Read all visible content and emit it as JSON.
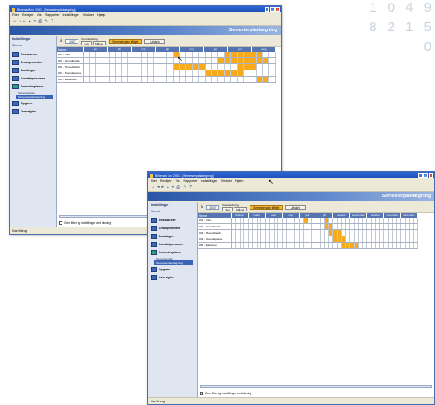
{
  "background_digits": [
    "1 0 4 9",
    "8 2 1 5 0"
  ],
  "window_title": "Birkerød Kro 2000 - [Semesterplanlægning]",
  "menu": [
    "Filer",
    "Rediger",
    "Vis",
    "Rapporter",
    "Indstillinger",
    "Vinduer",
    "Hjælp"
  ],
  "toolbar_tools": [
    "⌂",
    "◂",
    "▸",
    "▴",
    "▾",
    "⎙",
    "✎",
    "?"
  ],
  "header_title": "Semesterplanlægning",
  "sidebar": {
    "head": "Indstillinger",
    "sub": "Skema",
    "items": [
      {
        "label": "Ressourcer",
        "active": false
      },
      {
        "label": "Arrangementer",
        "active": false
      },
      {
        "label": "Bookinger",
        "active": false
      },
      {
        "label": "Kontaktpersoner",
        "active": false
      },
      {
        "label": "Semesterplaner",
        "active": true,
        "children": [
          {
            "label": "Semesterplan",
            "selected": false
          },
          {
            "label": "Semesterplanlægning",
            "selected": true
          }
        ]
      },
      {
        "label": "Opgaver",
        "active": false
      },
      {
        "label": "Oversigter",
        "active": false
      }
    ]
  },
  "filters": {
    "year_label": "År",
    "year_value": "2007",
    "period_caption": "Periodevisning",
    "period_buttons": [
      "Uge",
      "Måned"
    ],
    "orange_button": "Semesterplan tilføjet",
    "plain_button": "Udskriv"
  },
  "grid": {
    "row_header": "Navne",
    "months1": [
      "jan",
      "feb",
      "mar",
      "apr",
      "maj",
      "jun",
      "jul",
      "aug"
    ],
    "months2": [
      "februar",
      "marts",
      "april",
      "maj",
      "juni",
      "juli",
      "august",
      "september",
      "oktober",
      "november",
      "december"
    ],
    "rows": [
      {
        "label": "001 - Intro",
        "cells1": [
          0,
          0,
          0,
          0,
          0,
          0,
          0,
          0,
          0,
          0,
          0,
          0,
          0,
          0,
          1,
          0,
          0,
          0,
          0,
          0,
          0,
          0,
          1,
          1,
          1,
          1,
          1,
          1,
          0,
          0
        ],
        "cells2": [
          0,
          0,
          0,
          0,
          0,
          0,
          0,
          0,
          0,
          0,
          0,
          0,
          0,
          0,
          0,
          0,
          0,
          1,
          0,
          0,
          0,
          0,
          1,
          0,
          0,
          0,
          0,
          0,
          0,
          0,
          0,
          0,
          0,
          0,
          0,
          0,
          0,
          0,
          0,
          0,
          0,
          0,
          0,
          0
        ]
      },
      {
        "label": "002 - Grundforløb",
        "cells1": [
          0,
          0,
          0,
          0,
          0,
          0,
          0,
          0,
          0,
          0,
          0,
          0,
          0,
          0,
          0,
          0,
          0,
          0,
          0,
          0,
          0,
          1,
          1,
          1,
          1,
          1,
          1,
          1,
          1,
          0
        ],
        "cells2": [
          0,
          0,
          0,
          0,
          0,
          0,
          0,
          0,
          0,
          0,
          0,
          0,
          0,
          0,
          0,
          0,
          0,
          0,
          0,
          0,
          0,
          0,
          1,
          1,
          0,
          0,
          0,
          0,
          0,
          0,
          0,
          0,
          0,
          0,
          0,
          0,
          0,
          0,
          0,
          0,
          0,
          0,
          0,
          0
        ]
      },
      {
        "label": "003 - Hovedforløb",
        "cells1": [
          0,
          0,
          0,
          0,
          0,
          0,
          0,
          0,
          0,
          0,
          0,
          0,
          0,
          0,
          1,
          1,
          1,
          1,
          1,
          0,
          0,
          0,
          0,
          0,
          1,
          1,
          1,
          0,
          0,
          0
        ],
        "cells2": [
          0,
          0,
          0,
          0,
          0,
          0,
          0,
          0,
          0,
          0,
          0,
          0,
          0,
          0,
          0,
          0,
          0,
          0,
          0,
          0,
          0,
          0,
          0,
          1,
          1,
          1,
          0,
          0,
          0,
          0,
          0,
          0,
          0,
          0,
          0,
          0,
          0,
          0,
          0,
          0,
          0,
          0,
          0,
          0
        ]
      },
      {
        "label": "004 - Svendeprøve",
        "cells1": [
          0,
          0,
          0,
          0,
          0,
          0,
          0,
          0,
          0,
          0,
          0,
          0,
          0,
          0,
          0,
          0,
          0,
          0,
          0,
          1,
          1,
          1,
          1,
          1,
          1,
          0,
          0,
          0,
          0,
          0
        ],
        "cells2": [
          0,
          0,
          0,
          0,
          0,
          0,
          0,
          0,
          0,
          0,
          0,
          0,
          0,
          0,
          0,
          0,
          0,
          0,
          0,
          0,
          0,
          0,
          0,
          0,
          1,
          1,
          1,
          0,
          0,
          0,
          0,
          0,
          0,
          0,
          0,
          0,
          0,
          0,
          0,
          0,
          0,
          0,
          0,
          0
        ]
      },
      {
        "label": "005 - Eksamen",
        "cells1": [
          0,
          0,
          0,
          0,
          0,
          0,
          0,
          0,
          0,
          0,
          0,
          0,
          0,
          0,
          0,
          0,
          0,
          0,
          0,
          0,
          0,
          0,
          0,
          0,
          0,
          0,
          0,
          1,
          1,
          0
        ],
        "cells2": [
          0,
          0,
          0,
          0,
          0,
          0,
          0,
          0,
          0,
          0,
          0,
          0,
          0,
          0,
          0,
          0,
          0,
          0,
          0,
          0,
          0,
          0,
          0,
          0,
          0,
          0,
          1,
          1,
          1,
          1,
          0,
          0,
          0,
          0,
          0,
          0,
          0,
          0,
          0,
          0,
          0,
          0,
          0,
          0
        ]
      }
    ]
  },
  "footer_check_label": "Gem filter og indstillinger ved lukning",
  "status_text": "Klar til brug",
  "colors": {
    "titlebar": "#2f67d6",
    "header": "#2956a7",
    "accent_orange": "#f7aa1c",
    "grid_header": "#5474b2"
  },
  "window_icons": [
    "minimize-icon",
    "maximize-icon",
    "close-icon"
  ]
}
